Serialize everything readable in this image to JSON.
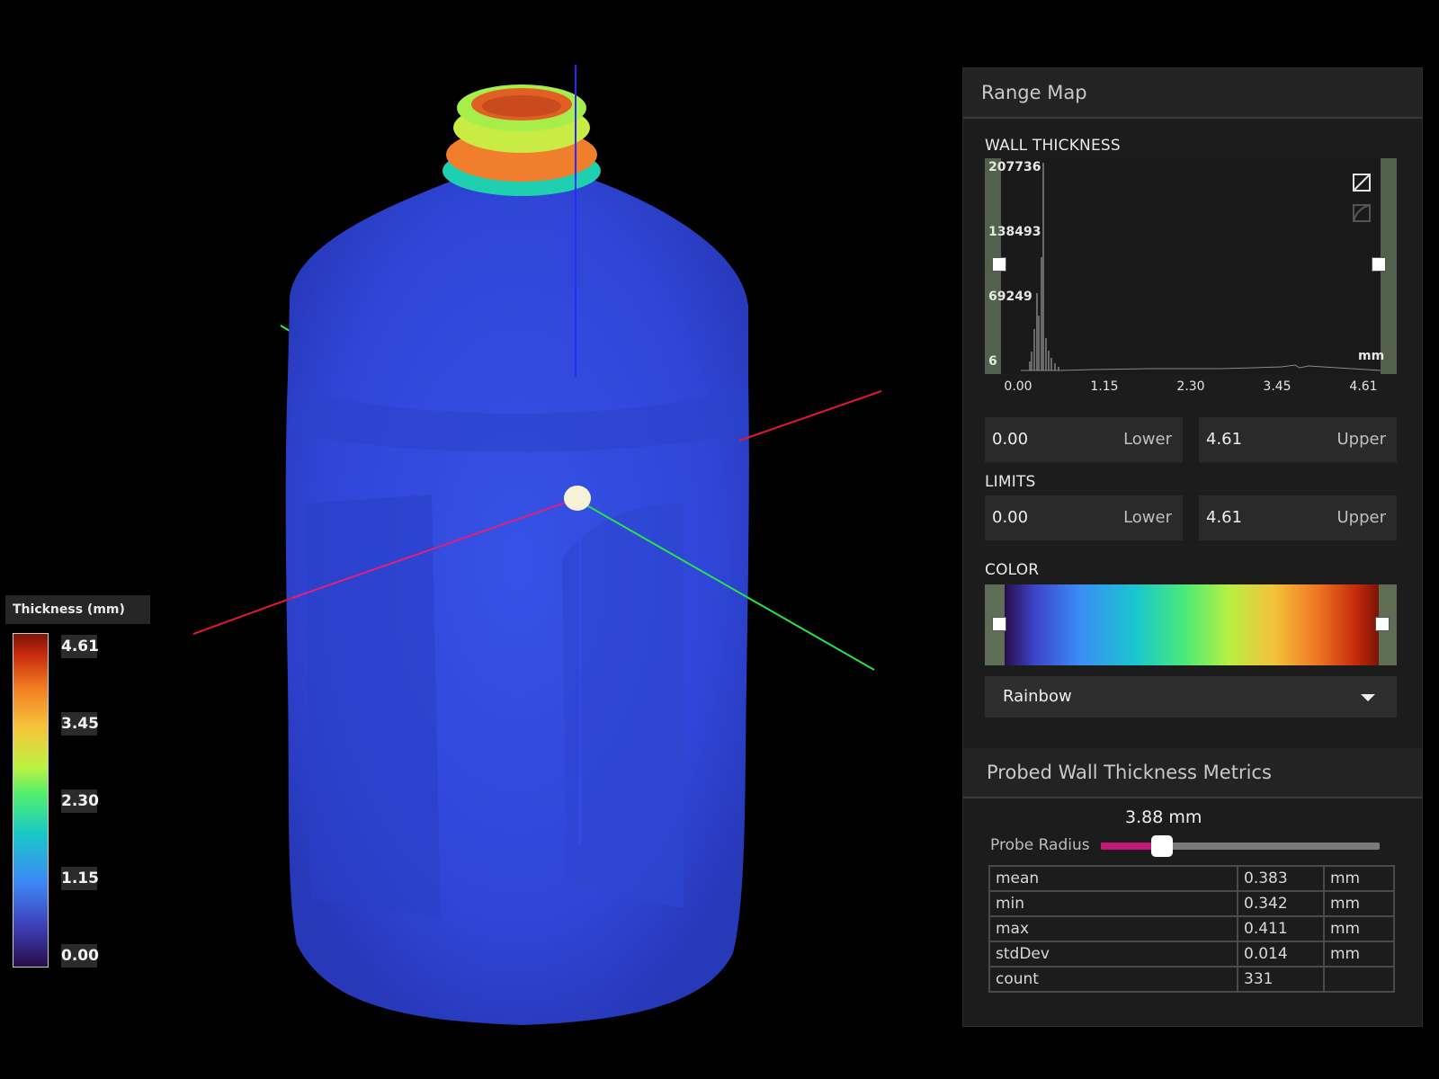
{
  "legend": {
    "title": "Thickness (mm)",
    "ticks": [
      "4.61",
      "3.45",
      "2.30",
      "1.15",
      "0.00"
    ]
  },
  "panel": {
    "range_map_title": "Range Map",
    "wall_thickness": {
      "label": "WALL THICKNESS",
      "y_ticks": [
        "207736",
        "138493",
        "69249",
        "6"
      ],
      "x_ticks": [
        "0.00",
        "1.15",
        "2.30",
        "3.45",
        "4.61"
      ],
      "unit": "mm",
      "lower_value": "0.00",
      "lower_label": "Lower",
      "upper_value": "4.61",
      "upper_label": "Upper"
    },
    "limits": {
      "label": "LIMITS",
      "lower_value": "0.00",
      "lower_label": "Lower",
      "upper_value": "4.61",
      "upper_label": "Upper"
    },
    "color": {
      "label": "COLOR",
      "colormap": "Rainbow"
    },
    "probe": {
      "title": "Probed Wall Thickness Metrics",
      "radius_label": "Probe Radius",
      "radius_value": "3.88 mm",
      "slider_fraction": 0.22,
      "metrics": [
        {
          "name": "mean",
          "value": "0.383",
          "unit": "mm"
        },
        {
          "name": "min",
          "value": "0.342",
          "unit": "mm"
        },
        {
          "name": "max",
          "value": "0.411",
          "unit": "mm"
        },
        {
          "name": "stdDev",
          "value": "0.014",
          "unit": "mm"
        },
        {
          "name": "count",
          "value": "331",
          "unit": ""
        }
      ]
    }
  }
}
